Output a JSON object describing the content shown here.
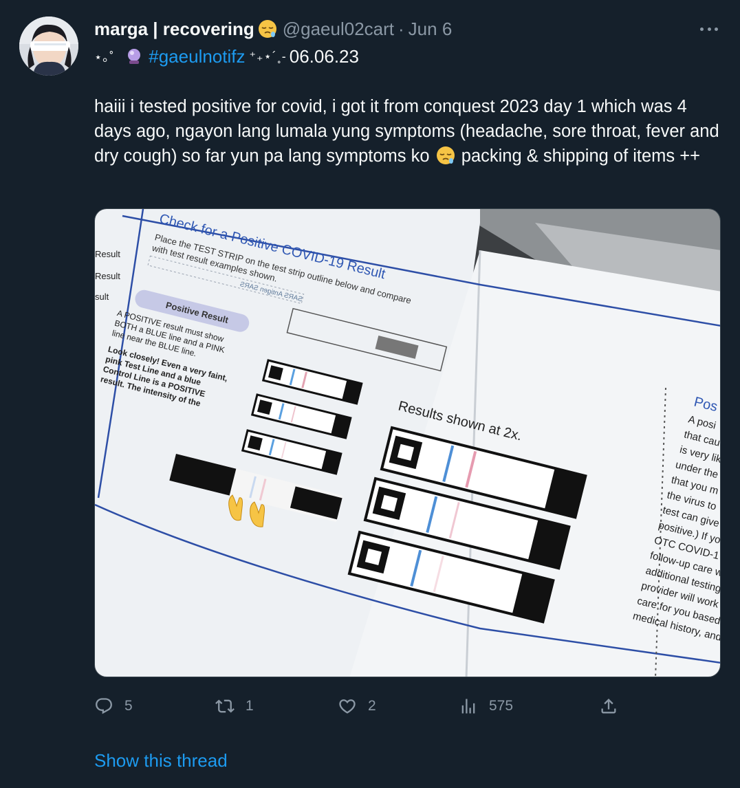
{
  "author": {
    "display_name": "marga | recovering",
    "handle": "@gaeul02cart",
    "separator": "·",
    "date": "Jun 6"
  },
  "bio_line": {
    "sparkle_prefix": "⋆｡˚",
    "hashtag": "#gaeulnotifz",
    "sparkle_suffix": "⁺₊⋆´˳-",
    "date": "06.06.23"
  },
  "tweet": {
    "text_part1": "haiii i tested positive for covid, i got it from conquest 2023 day 1 which was 4 days ago, ngayon lang lumala yung symptoms (headache, sore throat, fever and dry cough) so far yun pa lang symptoms ko",
    "text_part2": " packing & shipping of items ++"
  },
  "media": {
    "heading": "Check for a Positive COVID-19 Result",
    "instruction_1": "Place the TEST STRIP on the test strip outline below and compare",
    "instruction_2": "with test result examples shown.",
    "positive_label": "Positive Result",
    "body_1": "A POSITIVE result must show",
    "body_2": "BOTH a BLUE line and a PINK",
    "body_3": "line near the BLUE line.",
    "body_4": "Look closely! Even a very faint,",
    "body_5": "pink Test Line and a blue",
    "body_6": "Control Line is a POSITIVE",
    "body_7": "result. The intensity of the",
    "results_caption": "Results shown at 2x.",
    "side_result_1": "Result",
    "side_result_2": "Result",
    "side_result_3": "sult",
    "right_page_title": "Pos",
    "right_lines": [
      "A posi",
      "that cau",
      "is very lik",
      "under the",
      "that you m",
      "the virus to",
      "test can give",
      "positive.) If yo",
      "OTC COVID-1",
      "follow-up care w",
      "additional testing",
      "provider will work",
      "care for you based",
      "medical history, and"
    ],
    "mirrored_text": "SARS Antigen SARS"
  },
  "actions": {
    "replies": "5",
    "retweets": "1",
    "likes": "2",
    "views": "575"
  },
  "show_thread": "Show this thread",
  "colors": {
    "background": "#15202b",
    "primary_text": "#f7f9f9",
    "secondary_text": "#8b98a5",
    "accent": "#1d9bf0"
  },
  "icons": [
    "sleepy-face-icon",
    "crystal-ball-icon",
    "reply-icon",
    "retweet-icon",
    "like-icon",
    "views-icon",
    "share-icon",
    "more-icon",
    "raised-hands-icon"
  ]
}
